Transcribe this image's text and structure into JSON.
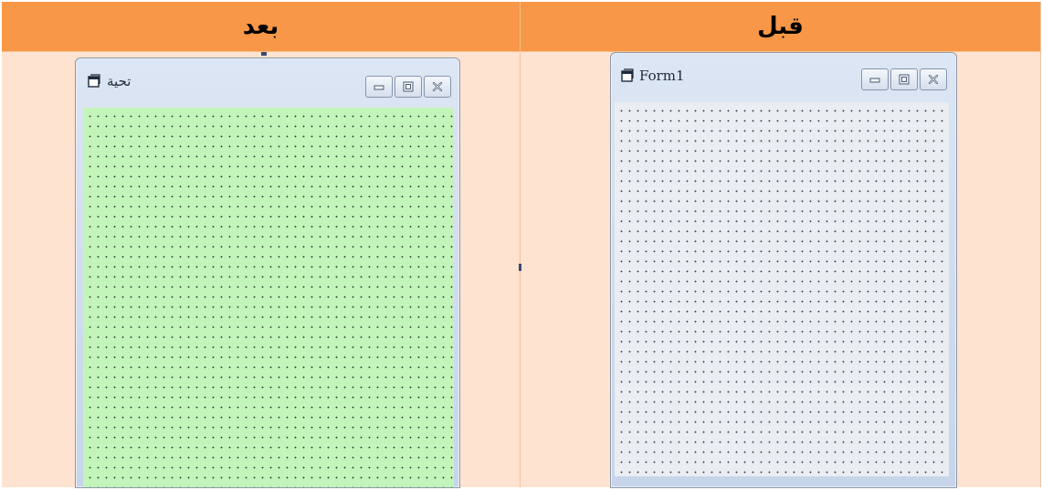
{
  "headers": {
    "after": "بعد",
    "before": "قبل"
  },
  "after_form": {
    "title": "تحية",
    "form_color": "#c3f5bb"
  },
  "before_form": {
    "title": "Form1",
    "form_color": "#eaedf2"
  },
  "controls": [
    "minimize",
    "maximize",
    "close"
  ],
  "colors": {
    "header": "#f79747",
    "cell": "#fde3d0"
  }
}
